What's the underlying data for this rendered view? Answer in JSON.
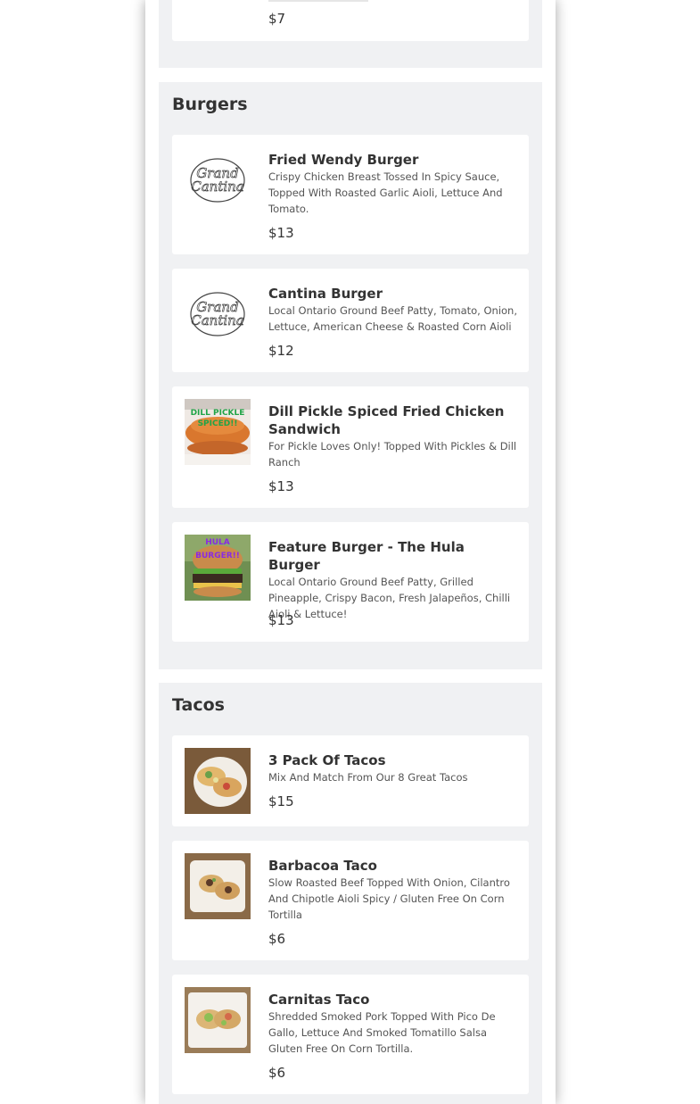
{
  "top_item": {
    "price": "$7"
  },
  "sections": [
    {
      "title": "Burgers",
      "items": [
        {
          "name": "Fried Wendy Burger",
          "description": "Crispy Chicken Breast Tossed In Spicy Sauce, Topped With Roasted Garlic Aioli, Lettuce And Tomato.",
          "price": "$13",
          "image": "grand-cantina-logo",
          "logo_text": [
            "Grand",
            "Cantina"
          ]
        },
        {
          "name": "Cantina Burger",
          "description": "Local Ontario Ground Beef Patty, Tomato, Onion, Lettuce, American Cheese & Roasted Corn Aioli",
          "price": "$12",
          "image": "grand-cantina-logo",
          "logo_text": [
            "Grand",
            "Cantina"
          ]
        },
        {
          "name": "Dill Pickle Spiced Fried Chicken Sandwich",
          "description": "For Pickle Loves Only! Topped With Pickles & Dill Ranch",
          "price": "$13",
          "image": "chicken-sandwich-photo",
          "photo_text": [
            "DILL PICKLE",
            "SPICED!!"
          ]
        },
        {
          "name": "Feature Burger - The Hula Burger",
          "description": "Local Ontario Ground Beef Patty, Grilled Pineapple, Crispy Bacon, Fresh Jalapeños, Chilli Aioli & Lettuce!",
          "price": "$13",
          "image": "burger-photo",
          "photo_text": [
            "HULA",
            "BURGER!!"
          ]
        }
      ]
    },
    {
      "title": "Tacos",
      "items": [
        {
          "name": "3 Pack Of Tacos",
          "description": "Mix And Match From Our 8 Great Tacos",
          "price": "$15",
          "image": "tacos-photo"
        },
        {
          "name": "Barbacoa Taco",
          "description": "Slow Roasted Beef Topped With Onion, Cilantro And Chipotle Aioli Spicy / Gluten Free On Corn Tortilla",
          "price": "$6",
          "image": "taco-photo"
        },
        {
          "name": "Carnitas Taco",
          "description": "Shredded Smoked Pork Topped With Pico De Gallo, Lettuce And Smoked Tomatillo Salsa Gluten Free On Corn Tortilla.",
          "price": "$6",
          "image": "taco-photo"
        }
      ]
    }
  ],
  "colors": {
    "page_bg": "#ffffff",
    "section_bg": "#f0f1f3",
    "card_bg": "#ffffff",
    "text": "#333333"
  }
}
